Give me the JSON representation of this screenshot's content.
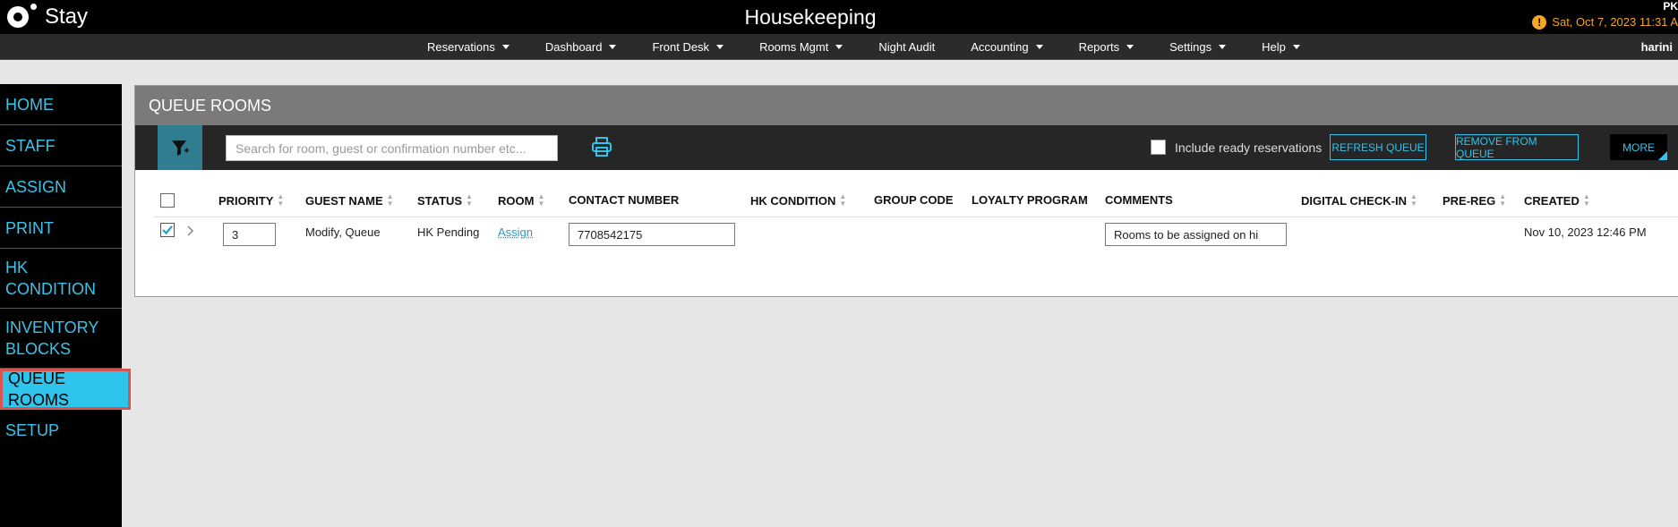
{
  "header": {
    "logo_text": "Stay",
    "title": "Housekeeping",
    "property_code": "PK",
    "datetime": "Sat, Oct 7, 2023 11:31 A"
  },
  "nav": {
    "items": [
      {
        "label": "Reservations",
        "dropdown": true
      },
      {
        "label": "Dashboard",
        "dropdown": true
      },
      {
        "label": "Front Desk",
        "dropdown": true
      },
      {
        "label": "Rooms Mgmt",
        "dropdown": true
      },
      {
        "label": "Night Audit",
        "dropdown": false
      },
      {
        "label": "Accounting",
        "dropdown": true
      },
      {
        "label": "Reports",
        "dropdown": true
      },
      {
        "label": "Settings",
        "dropdown": true
      },
      {
        "label": "Help",
        "dropdown": true
      }
    ],
    "user": "harini"
  },
  "sidebar": {
    "items": [
      {
        "label": "HOME",
        "active": false
      },
      {
        "label": "STAFF",
        "active": false
      },
      {
        "label": "ASSIGN",
        "active": false
      },
      {
        "label": "PRINT",
        "active": false
      },
      {
        "label": "HK\nCONDITION",
        "active": false
      },
      {
        "label": "INVENTORY\nBLOCKS",
        "active": false
      },
      {
        "label": "QUEUE ROOMS",
        "active": true
      },
      {
        "label": "SETUP",
        "active": false
      }
    ]
  },
  "panel": {
    "title": "QUEUE ROOMS",
    "search_placeholder": "Search for room, guest or confirmation number etc...",
    "include_label": "Include ready reservations",
    "refresh_label": "REFRESH QUEUE",
    "remove_label": "REMOVE FROM QUEUE",
    "more_label": "MORE"
  },
  "table": {
    "headers": {
      "priority": "PRIORITY",
      "guest_name": "GUEST NAME",
      "status": "STATUS",
      "room": "ROOM",
      "contact": "CONTACT NUMBER",
      "hk_condition": "HK CONDITION",
      "group_code": "GROUP CODE",
      "loyalty": "LOYALTY PROGRAM",
      "comments": "COMMENTS",
      "digital_checkin": "DIGITAL CHECK-IN",
      "pre_reg": "PRE-REG",
      "created": "CREATED"
    },
    "rows": [
      {
        "checked": true,
        "priority": "3",
        "guest_name": "Modify, Queue",
        "status": "HK Pending",
        "room": "Assign",
        "contact": "7708542175",
        "hk_condition": "",
        "group_code": "",
        "loyalty": "",
        "comments": "Rooms to be assigned on hi",
        "digital_checkin": "",
        "pre_reg": "",
        "created": "Nov 10, 2023 12:46 PM"
      }
    ]
  },
  "colors": {
    "accent": "#2ec4ec",
    "warning": "#f5a623",
    "link": "#2a9ac8"
  }
}
